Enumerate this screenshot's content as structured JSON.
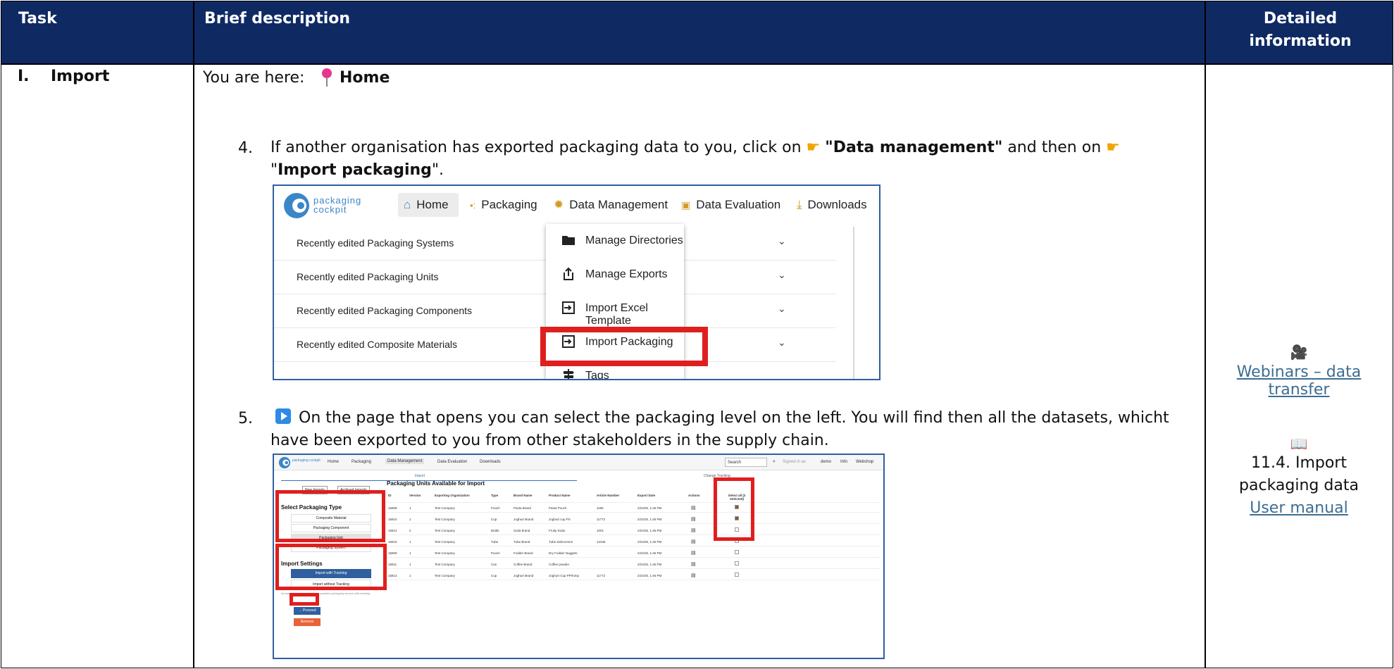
{
  "header": {
    "task": "Task",
    "brief": "Brief description",
    "detailed_line1": "Detailed",
    "detailed_line2": "information"
  },
  "row": {
    "task_number": "I.",
    "task_name": "Import",
    "you_are_here": "You are here:",
    "location": "Home"
  },
  "steps": [
    {
      "number": "4.",
      "line1_a": "If another organisation has exported packaging data to you, click on",
      "line1_b": "\"Data management\"",
      "line1_c": "and then on",
      "line2_quote_open": "\"",
      "line2_bold": "Import packaging",
      "line2_end": "\"."
    },
    {
      "number": "5.",
      "line1": "On the page that opens you can select the packaging level on the left. You will find then all the datasets, whicht",
      "line2": "have been exported to you from other stakeholders in the supply chain."
    }
  ],
  "screenshot1": {
    "logo_line1": "packaging",
    "logo_line2": "cockpit",
    "nav": [
      "Home",
      "Packaging",
      "Data Management",
      "Data Evaluation",
      "Downloads"
    ],
    "list": [
      "Recently edited Packaging Systems",
      "Recently edited Packaging Units",
      "Recently edited Packaging Components",
      "Recently edited Composite Materials"
    ],
    "menu": [
      "Manage Directories",
      "Manage Exports",
      "Import Excel Template",
      "Import Packaging",
      "Tags"
    ]
  },
  "screenshot2": {
    "nav": [
      "Home",
      "Packaging",
      "Data Management",
      "Data Evaluation",
      "Downloads"
    ],
    "search": "Search",
    "signed_in": "Signed in as",
    "user": "demo",
    "info": "Info",
    "webshop": "Webshop",
    "tab_import": "Import",
    "tab_change": "Change Tracking",
    "btn_new": "New Imports",
    "btn_archived": "Archived Imports",
    "select_title": "Select Packaging Type",
    "types": [
      "Composite Material",
      "Packaging Component",
      "Packaging Unit",
      "Packaging System"
    ],
    "settings_title": "Import Settings",
    "with_tracking": "Import with Tracking",
    "without_tracking": "Import without Tracking",
    "settings_note": "Accept changes and create an updated packaging version with tracking.",
    "proceed": "Proceed",
    "remove": "Remove",
    "table_title": "Packaging Units Available for Import",
    "columns": [
      "ID",
      "Version",
      "Exporting Organization",
      "Type",
      "Brand Name",
      "Product Name",
      "Article Number",
      "Export Date",
      "Actions",
      "Select all (2 Selected)"
    ],
    "rows": [
      [
        "15808",
        "1",
        "Test Company",
        "Pouch",
        "Pasta Brand",
        "Pasta Pouch",
        "1156",
        "2/24/25, 1:46 PM"
      ],
      [
        "15810",
        "1",
        "Test Company",
        "Cup",
        "Joghurt Brand",
        "Joghurt cup PS",
        "11772",
        "2/24/25, 1:46 PM"
      ],
      [
        "15814",
        "2",
        "Test Company",
        "Bottle",
        "Soda brand",
        "Fruity Soda",
        "1001",
        "2/24/25, 1:46 PM"
      ],
      [
        "15815",
        "1",
        "Test Company",
        "Tube",
        "Tube Brand",
        "Tube Zahncreme",
        "12346",
        "2/24/25, 1:46 PM"
      ],
      [
        "15809",
        "1",
        "Test Company",
        "Pouch",
        "Fodder Brand",
        "Dry Fodder Nuggets",
        "",
        "2/24/25, 1:46 PM"
      ],
      [
        "15811",
        "1",
        "Test Company",
        "Can",
        "Coffee Brand",
        "Coffee powder",
        "",
        "2/24/25, 1:46 PM"
      ],
      [
        "15813",
        "1",
        "Test Company",
        "Cup",
        "Joghurt Brand",
        "Joghurt Cup PP/Inmp",
        "11772",
        "2/24/25, 1:46 PM"
      ]
    ],
    "checked": [
      true,
      true,
      false,
      false,
      false,
      false,
      false
    ]
  },
  "detailed": {
    "webinar_line1": "Webinars – data",
    "webinar_line2": "transfer",
    "manual_line1": "11.4. Import",
    "manual_line2": "packaging data",
    "manual_link": "User manual"
  }
}
